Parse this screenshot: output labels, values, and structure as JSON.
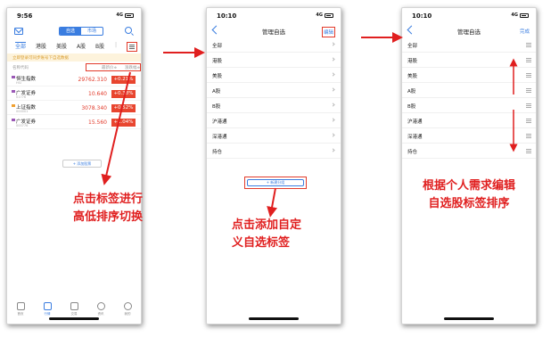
{
  "phone1": {
    "time": "9:56",
    "network": "4G",
    "segment": [
      "自选",
      "市场"
    ],
    "tabs": [
      "全部",
      "港股",
      "美股",
      "A股",
      "B股",
      "|"
    ],
    "banner": "立即登录可同步账号下自选数据",
    "header": {
      "name": "名称代码",
      "price": "最新价≑",
      "change": "涨跌幅≑"
    },
    "rows": [
      {
        "name": "恒生指数",
        "code": "HSI",
        "price": "29762.310",
        "change": "+0.21%",
        "color": "#9b59b6"
      },
      {
        "name": "广发证券",
        "code": "01776",
        "price": "10.640",
        "change": "+0.38%",
        "color": "#9b59b6"
      },
      {
        "name": "上证指数",
        "code": "000001",
        "price": "3078.340",
        "change": "+0.52%",
        "color": "#f0a030"
      },
      {
        "name": "广发证券",
        "code": "000776",
        "price": "15.560",
        "change": "+1.04%",
        "color": "#9b59b6"
      }
    ],
    "add_button": "+ 添加股票",
    "bottom_nav": [
      "首页",
      "行情",
      "交易",
      "资讯",
      "我的"
    ]
  },
  "phone2": {
    "time": "10:10",
    "network": "4G",
    "title": "管理自选",
    "edit": "编辑",
    "items": [
      "全部",
      "港股",
      "美股",
      "A股",
      "B股",
      "沪港通",
      "深港通",
      "持仓"
    ],
    "new_group": "+ 新建分组"
  },
  "phone3": {
    "time": "10:10",
    "network": "4G",
    "title": "管理自选",
    "done": "完成",
    "items": [
      "全部",
      "港股",
      "美股",
      "A股",
      "B股",
      "沪港通",
      "深港通",
      "持仓"
    ]
  },
  "annotations": {
    "a1": [
      "点击标签进行",
      "高低排序切换"
    ],
    "a2": [
      "点击添加自定",
      "义自选标签"
    ],
    "a3": [
      "根据个人需求编辑",
      "自选股标签排序"
    ]
  },
  "colors": {
    "accent": "#3a7de0",
    "red": "#e01f1f"
  }
}
